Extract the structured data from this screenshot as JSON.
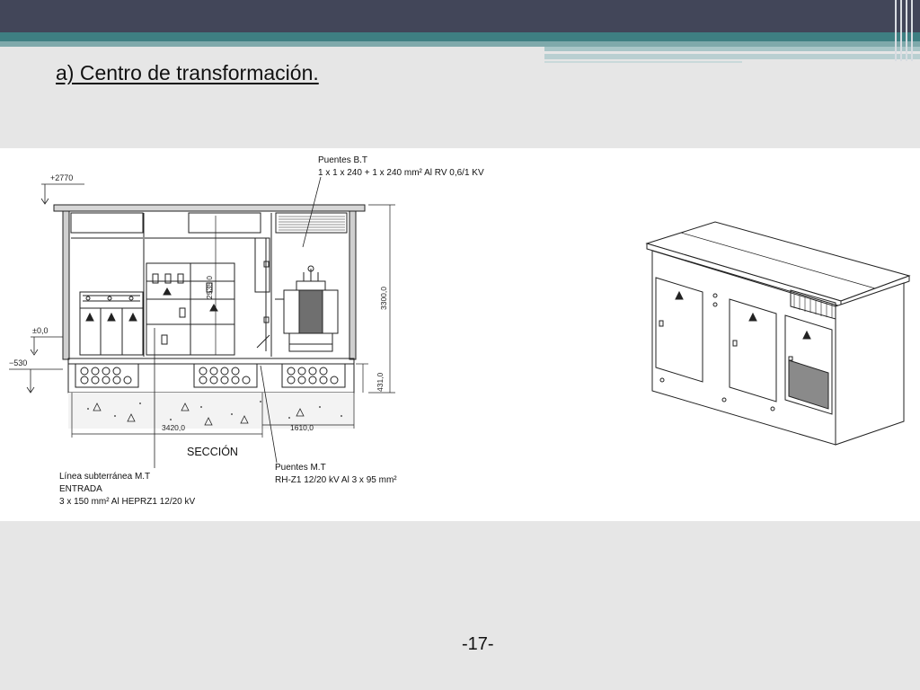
{
  "slide": {
    "title": "a) Centro de transformación.",
    "page_number": "-17-"
  },
  "drawing": {
    "level_top": "+2770",
    "level_ground": "±0,0",
    "level_bottom": "−530",
    "dim_height_total": "3300,0",
    "dim_inner_height": "2535,0",
    "dim_base": "431,0",
    "dim_length": "3420,0",
    "dim_length2": "1610,0",
    "section_label": "SECCIÓN",
    "bt_bridges_title": "Puentes B.T",
    "bt_bridges_spec": "1 x 1 x 240 + 1 x 240 mm² Al RV 0,6/1 KV",
    "mt_line_title": "Línea subterránea M.T",
    "mt_line_entry": "ENTRADA",
    "mt_line_spec": "3 x 150 mm² Al HEPRZ1 12/20 kV",
    "mt_bridges_title": "Puentes M.T",
    "mt_bridges_spec": "RH-Z1 12/20 kV Al 3 x 95 mm²"
  }
}
